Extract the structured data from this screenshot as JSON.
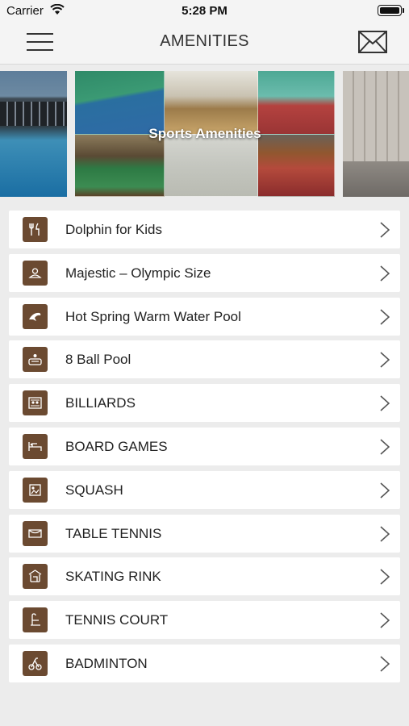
{
  "status_bar": {
    "carrier": "Carrier",
    "time": "5:28 PM"
  },
  "nav": {
    "title": "AMENITIES",
    "menu_icon": "hamburger-menu-icon",
    "mail_icon": "envelope-icon"
  },
  "carousel": {
    "active_label": "Sports Amenities"
  },
  "amenities": [
    {
      "label": "Dolphin for Kids",
      "icon": "restaurant-icon"
    },
    {
      "label": "Majestic – Olympic Size",
      "icon": "spa-icon"
    },
    {
      "label": "Hot Spring Warm Water Pool",
      "icon": "dolphin-icon"
    },
    {
      "label": "8 Ball Pool",
      "icon": "hot-tub-icon"
    },
    {
      "label": "BILLIARDS",
      "icon": "billiards-icon"
    },
    {
      "label": "BOARD GAMES",
      "icon": "board-games-icon"
    },
    {
      "label": "SQUASH",
      "icon": "squash-icon"
    },
    {
      "label": "TABLE TENNIS",
      "icon": "table-tennis-icon"
    },
    {
      "label": "SKATING RINK",
      "icon": "skating-rink-icon"
    },
    {
      "label": "TENNIS COURT",
      "icon": "tennis-court-icon"
    },
    {
      "label": "BADMINTON",
      "icon": "badminton-icon"
    }
  ],
  "colors": {
    "icon_background": "#6b4a31",
    "page_background": "#ececec",
    "row_background": "#ffffff"
  }
}
